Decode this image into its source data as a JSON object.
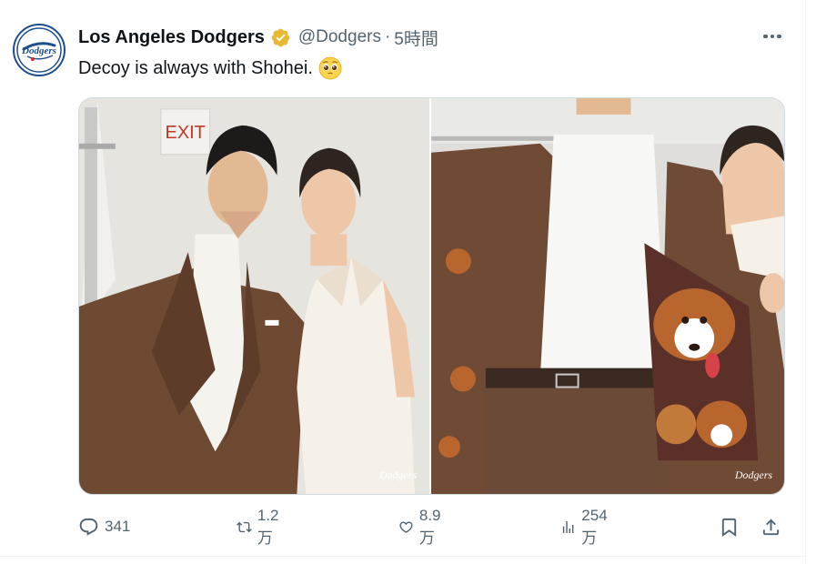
{
  "tweet": {
    "display_name": "Los Angeles Dodgers",
    "handle": "@Dodgers",
    "separator": "·",
    "time": "5時間",
    "text": "Decoy is always with Shohei.",
    "emoji": "pleading-face-emoji"
  },
  "avatar": {
    "logo_text": "Dodgers",
    "brand_color": "#1f4e8c",
    "accent_color": "#d9262e"
  },
  "media": {
    "left_photo": {
      "sign_text": "EXIT",
      "watermark": "Dodgers"
    },
    "right_photo": {
      "watermark": "Dodgers"
    }
  },
  "actions": {
    "reply_count": "341",
    "repost_count": "1.2万",
    "like_count": "8.9万",
    "views_count": "254万"
  },
  "colors": {
    "verified": "#e8b932",
    "muted_text": "#536471",
    "border": "#cfd9de"
  }
}
